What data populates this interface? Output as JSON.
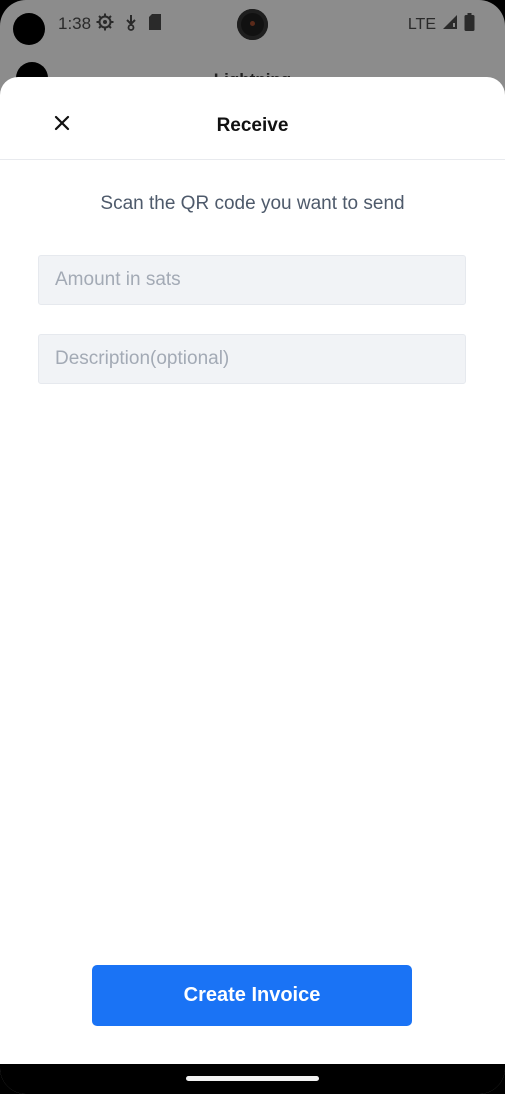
{
  "status_bar": {
    "time": "1:38",
    "network": "LTE",
    "icons": [
      "settings-icon",
      "download-icon",
      "sd-card-icon",
      "signal-icon",
      "battery-icon"
    ]
  },
  "background_app": {
    "title": "Lightning"
  },
  "sheet": {
    "title": "Receive",
    "close_icon": "close-icon",
    "instruction": "Scan the QR code you want to send",
    "amount_field": {
      "value": "",
      "placeholder": "Amount in sats"
    },
    "description_field": {
      "value": "",
      "placeholder": "Description(optional)"
    },
    "create_button_label": "Create Invoice"
  },
  "colors": {
    "accent": "#1a73f5",
    "input_bg": "#f1f3f6",
    "instruction_text": "#4e5a6b",
    "placeholder_text": "#a3aab5"
  }
}
